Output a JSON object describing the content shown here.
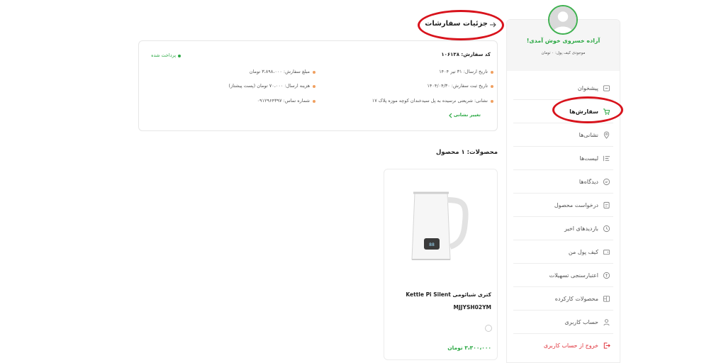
{
  "header": {
    "title": "جزئیات سفارشات"
  },
  "profile": {
    "greeting": "آزاده خسروی خوش آمدی!",
    "wallet": "موجودی کیف پول: ۰ تومان"
  },
  "sidebar": {
    "items": [
      {
        "label": "پیشخوان",
        "icon": "dashboard-icon"
      },
      {
        "label": "سفارش‌ها",
        "icon": "cart-icon"
      },
      {
        "label": "نشانی‌ها",
        "icon": "location-pin-icon"
      },
      {
        "label": "لیست‌ها",
        "icon": "list-icon"
      },
      {
        "label": "دیدگاه‌ها",
        "icon": "comment-icon"
      },
      {
        "label": "درخواست محصول",
        "icon": "request-icon"
      },
      {
        "label": "بازدیدهای اخیر",
        "icon": "clock-icon"
      },
      {
        "label": "کیف پول من",
        "icon": "wallet-icon"
      },
      {
        "label": "اعتبارسنجی تسهیلات",
        "icon": "credit-icon"
      },
      {
        "label": "محصولات کارکرده",
        "icon": "used-products-icon"
      },
      {
        "label": "حساب کاربری",
        "icon": "user-icon"
      },
      {
        "label": "خروج از حساب کاربری",
        "icon": "logout-icon"
      }
    ],
    "active_index": 1
  },
  "order": {
    "code": "کد سفارش: ۱۰۶۱۳۸",
    "status": "پرداخت شده",
    "send_date": "تاریخ ارسال: ۳۱ تیر ۱۴۰۴",
    "register_date": "تاریخ ثبت سفارش: ۱۴۰۴/۰۴/۳۰",
    "address": "نشانی: شریعتی نرسیده به پل سیدخندان کوچه موزه پلاک ۱۷",
    "amount": "مبلغ سفارش: ۳،۸۹۸،۰۰۰ تومان",
    "shipping": "هزینه ارسال: ۷۰،۰۰۰ تومان (پست پیشتاز)",
    "phone": "شماره تماس: ۰۹۱۲۹۶۴۳۹۷",
    "change_address": "تغییر نشانی"
  },
  "products": {
    "title": "محصولات: ۱ محصول",
    "items": [
      {
        "name": "کتری شیائومی Kettle Pi Silent MJJYSH02YM",
        "price": "۳،۳۰۰،۰۰۰ تومان"
      }
    ]
  },
  "colors": {
    "accent_green": "#2aa843",
    "annotation_red": "#d8131c",
    "logout_red": "#e0333c",
    "bullet_orange": "#f0a060"
  }
}
